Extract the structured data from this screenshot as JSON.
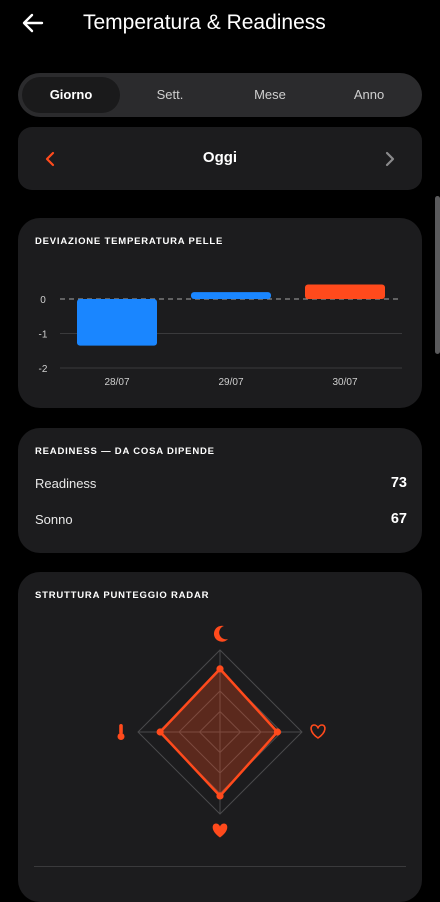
{
  "header": {
    "title": "Temperatura & Readiness",
    "back_icon": "arrow-left-icon"
  },
  "tabs": [
    {
      "label": "Giorno",
      "active": true
    },
    {
      "label": "Sett.",
      "active": false
    },
    {
      "label": "Mese",
      "active": false
    },
    {
      "label": "Anno",
      "active": false
    }
  ],
  "date_nav": {
    "label": "Oggi",
    "prev_icon": "chevron-left-icon",
    "next_icon": "chevron-right-icon"
  },
  "colors": {
    "accent": "#ff4a1c",
    "blue": "#1a86ff",
    "card": "#1c1c1e"
  },
  "temperature": {
    "title": "DEVIAZIONE TEMPERATURA PELLE",
    "chart_data": {
      "type": "bar",
      "title": "DEVIAZIONE TEMPERATURA PELLE",
      "categories": [
        "28/07",
        "29/07",
        "30/07"
      ],
      "values": [
        -1.35,
        0.2,
        0.42
      ],
      "colors": [
        "#1a86ff",
        "#1a86ff",
        "#ff4a1c"
      ],
      "yticks": [
        "0",
        "-1",
        "-2"
      ],
      "ylim": [
        -2,
        0.5
      ],
      "baseline": "dashed at 0"
    }
  },
  "readiness": {
    "title": "READINESS — DA COSA DIPENDE",
    "rows": [
      {
        "label": "Readiness",
        "value": "73"
      },
      {
        "label": "Sonno",
        "value": "67"
      }
    ]
  },
  "radar": {
    "title": "STRUTTURA PUNTEGGIO RADAR",
    "chart_data": {
      "type": "radar",
      "axes": [
        {
          "icon": "moon-icon",
          "value": 0.77
        },
        {
          "icon": "heart-outline-icon",
          "value": 0.7
        },
        {
          "icon": "heart-filled-icon",
          "value": 0.78
        },
        {
          "icon": "thermometer-icon",
          "value": 0.73
        }
      ],
      "rings": 4,
      "max": 1
    }
  }
}
